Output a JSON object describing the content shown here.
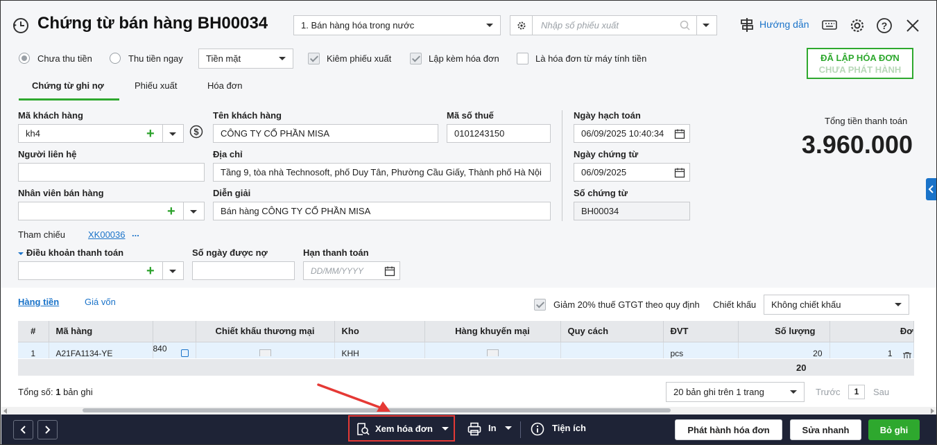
{
  "header": {
    "title": "Chứng từ bán hàng BH00034",
    "voucher_type": "1. Bán hàng hóa trong nước",
    "search_placeholder": "Nhập số phiếu xuất",
    "help_label": "Hướng dẫn"
  },
  "options": {
    "radio_unpaid": "Chưa thu tiền",
    "radio_paid": "Thu tiền ngay",
    "payment_method": "Tiền mặt",
    "chk_delivery": "Kiêm phiếu xuất",
    "chk_invoice": "Lập kèm hóa đơn",
    "chk_cash_register": "Là hóa đơn từ máy tính tiền"
  },
  "status_badge": {
    "line1": "ĐÃ LẬP HÓA ĐƠN",
    "line2": "CHƯA PHÁT HÀNH",
    "color": "#2ea82e"
  },
  "tabs": [
    "Chứng từ ghi nợ",
    "Phiếu xuất",
    "Hóa đơn"
  ],
  "form": {
    "customer_code_label": "Mã khách hàng",
    "customer_code": "kh4",
    "customer_name_label": "Tên khách hàng",
    "customer_name": "CÔNG TY CỔ PHẦN MISA",
    "tax_code_label": "Mã số thuế",
    "tax_code": "0101243150",
    "contact_label": "Người liên hệ",
    "contact": "",
    "address_label": "Địa chỉ",
    "address": "Tầng 9, tòa nhà Technosoft, phố Duy Tân, Phường Cầu Giấy, Thành phố Hà Nội",
    "salesperson_label": "Nhân viên bán hàng",
    "salesperson": "",
    "description_label": "Diễn giải",
    "description": "Bán hàng CÔNG TY CỔ PHẦN MISA",
    "reference_label": "Tham chiếu",
    "reference_link": "XK00036",
    "reference_more": "...",
    "payment_terms_label": "Điều khoản thanh toán",
    "credit_days_label": "Số ngày được nợ",
    "due_date_label": "Hạn thanh toán",
    "due_date_placeholder": "DD/MM/YYYY",
    "posting_date_label": "Ngày hạch toán",
    "posting_date": "06/09/2025 10:40:34",
    "voucher_date_label": "Ngày chứng từ",
    "voucher_date": "06/09/2025",
    "voucher_no_label": "Số chứng từ",
    "voucher_no": "BH00034"
  },
  "total": {
    "label": "Tổng tiền thanh toán",
    "value": "3.960.000"
  },
  "detail": {
    "tab_goods": "Hàng tiền",
    "tab_cost": "Giá vốn",
    "vat_reduction_label": "Giảm 20% thuế GTGT theo quy định",
    "discount_label": "Chiết khấu",
    "discount_value": "Không chiết khấu",
    "columns": [
      "#",
      "Mã hàng",
      "",
      "Chiết khấu thương mại",
      "Kho",
      "Hàng khuyến mại",
      "Quy cách",
      "ĐVT",
      "Số lượng",
      "Đơ"
    ],
    "row": {
      "no": "1",
      "code": "A21FA1134-YE",
      "extra": "840",
      "warehouse": "KHH",
      "unit": "pcs",
      "qty": "20",
      "price": "1"
    },
    "qty_total": "20",
    "record_count_prefix": "Tổng số:",
    "record_count": "1",
    "record_count_suffix": "bản ghi",
    "page_size": "20 bản ghi trên 1 trang",
    "prev": "Trước",
    "page": "1",
    "next": "Sau"
  },
  "footer": {
    "view_invoice": "Xem hóa đơn",
    "print": "In",
    "utilities": "Tiện ích",
    "issue_invoice": "Phát hành hóa đơn",
    "quick_edit": "Sửa nhanh",
    "cancel": "Bỏ ghi"
  },
  "colors": {
    "accent_blue": "#1a73c9",
    "green": "#2ea82e",
    "highlight_red": "#e53935"
  }
}
